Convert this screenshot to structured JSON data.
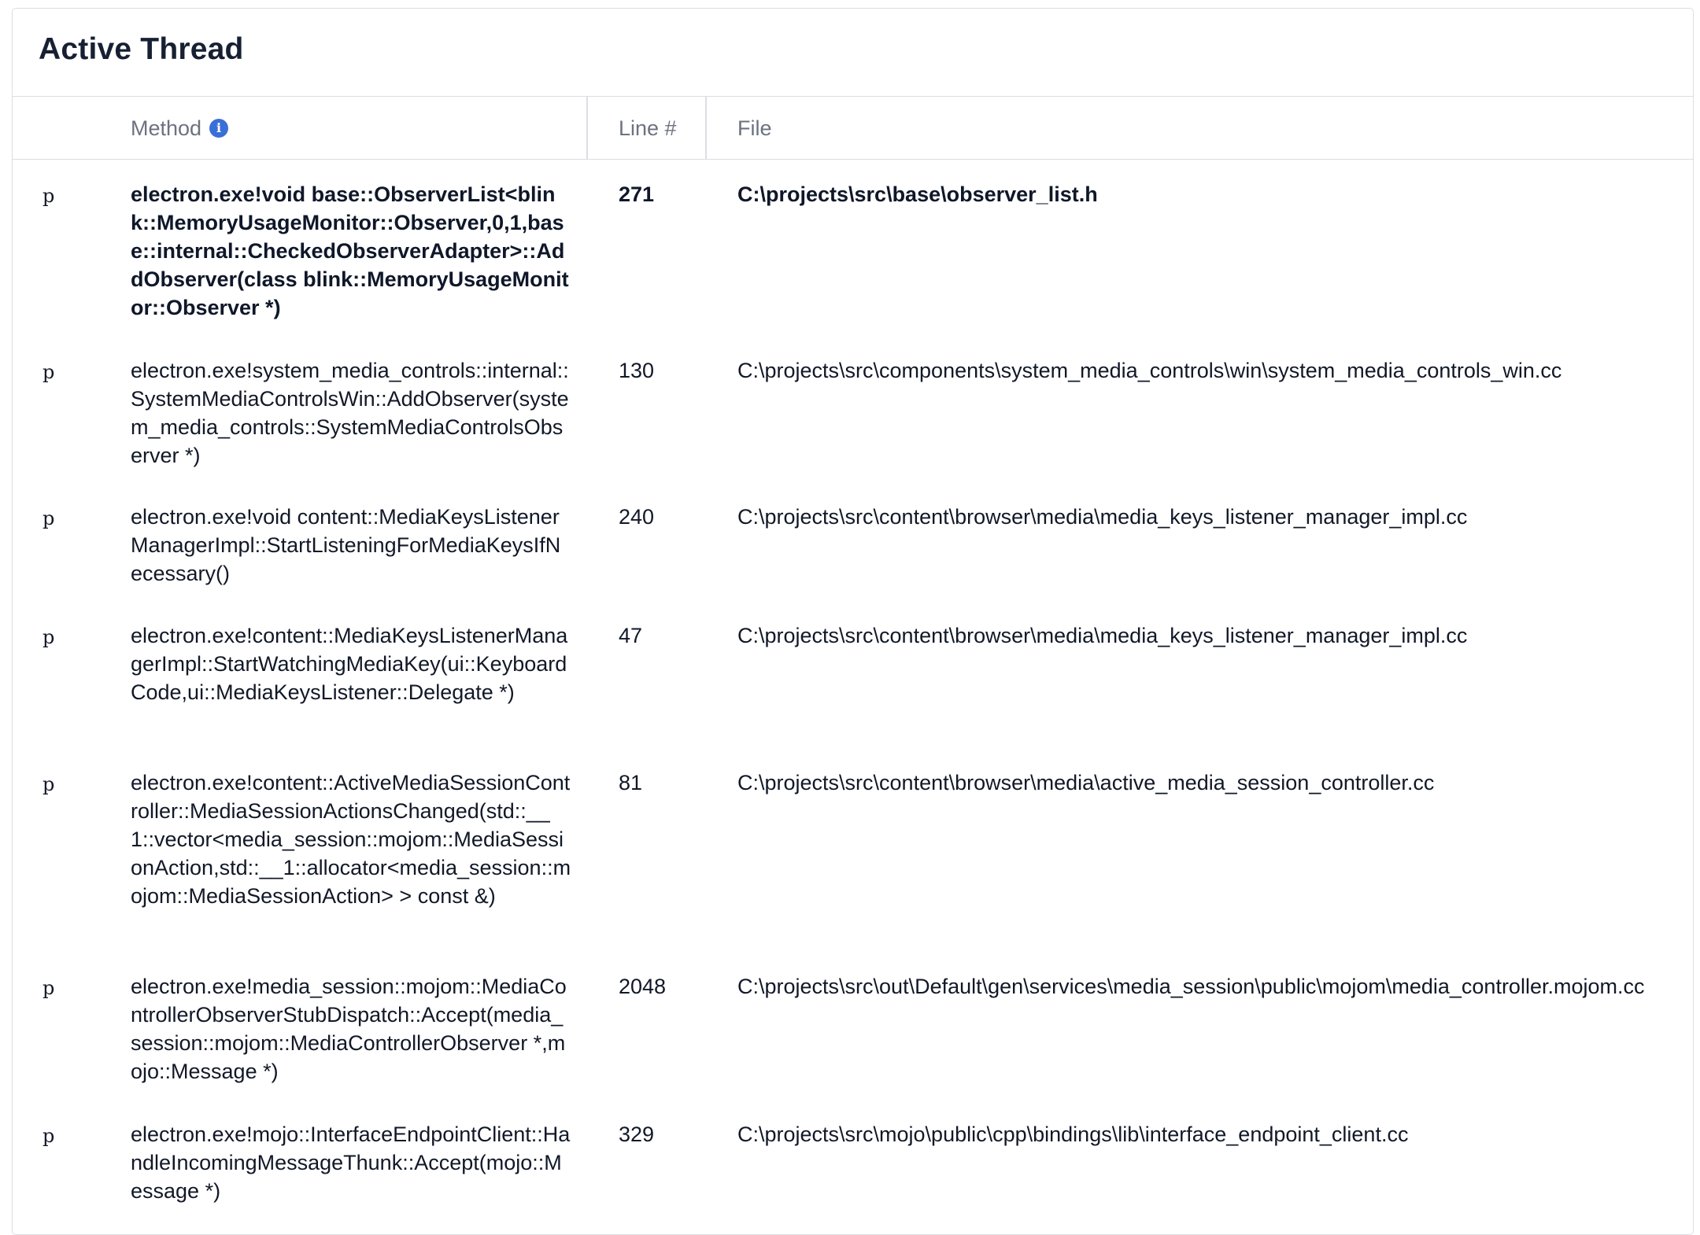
{
  "panel": {
    "title": "Active Thread"
  },
  "table": {
    "columns": {
      "method": "Method",
      "line": "Line #",
      "file": "File"
    },
    "info_icon_glyph": "i",
    "rows": [
      {
        "marker": "p",
        "method": "electron.exe!void base::ObserverList<blink::MemoryUsageMonitor::Observer,0,1,base::internal::CheckedObserverAdapter>::AddObserver(class blink::MemoryUsageMonitor::Observer *)",
        "line": "271",
        "file": "C:\\projects\\src\\base\\observer_list.h"
      },
      {
        "marker": "p",
        "method": "electron.exe!system_media_controls::internal::SystemMediaControlsWin::AddObserver(system_media_controls::SystemMediaControlsObserver *)",
        "line": "130",
        "file": "C:\\projects\\src\\components\\system_media_controls\\win\\system_media_controls_win.cc"
      },
      {
        "marker": "p",
        "method": "electron.exe!void content::MediaKeysListenerManagerImpl::StartListeningForMediaKeysIfNecessary()",
        "line": "240",
        "file": "C:\\projects\\src\\content\\browser\\media\\media_keys_listener_manager_impl.cc"
      },
      {
        "marker": "p",
        "method": "electron.exe!content::MediaKeysListenerManagerImpl::StartWatchingMediaKey(ui::KeyboardCode,ui::MediaKeysListener::Delegate *)",
        "line": "47",
        "file": "C:\\projects\\src\\content\\browser\\media\\media_keys_listener_manager_impl.cc"
      },
      {
        "marker": "p",
        "method": "electron.exe!content::ActiveMediaSessionController::MediaSessionActionsChanged(std::__1::vector<media_session::mojom::MediaSessionAction,std::__1::allocator<media_session::mojom::MediaSessionAction> > const &)",
        "line": "81",
        "file": "C:\\projects\\src\\content\\browser\\media\\active_media_session_controller.cc"
      },
      {
        "marker": "p",
        "method": "electron.exe!media_session::mojom::MediaControllerObserverStubDispatch::Accept(media_session::mojom::MediaControllerObserver *,mojo::Message *)",
        "line": "2048",
        "file": "C:\\projects\\src\\out\\Default\\gen\\services\\media_session\\public\\mojom\\media_controller.mojom.cc"
      },
      {
        "marker": "p",
        "method": "electron.exe!mojo::InterfaceEndpointClient::HandleIncomingMessageThunk::Accept(mojo::Message *)",
        "line": "329",
        "file": "C:\\projects\\src\\mojo\\public\\cpp\\bindings\\lib\\interface_endpoint_client.cc"
      }
    ]
  }
}
